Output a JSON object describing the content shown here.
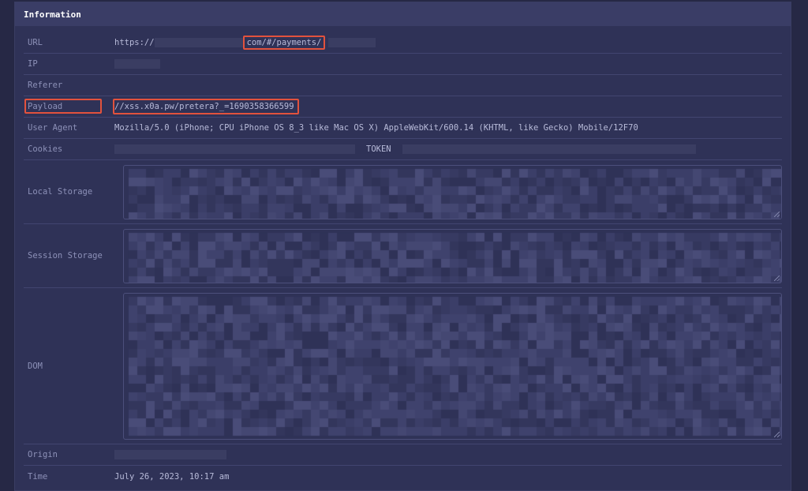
{
  "panel": {
    "title": "Information"
  },
  "fields": {
    "url": {
      "label": "URL",
      "prefix": "https://",
      "highlight": "com/#/payments/"
    },
    "ip": {
      "label": "IP"
    },
    "referer": {
      "label": "Referer"
    },
    "payload": {
      "label": "Payload",
      "value": "//xss.x0a.pw/pretera?_=1690358366599"
    },
    "user_agent": {
      "label": "User Agent",
      "value": "Mozilla/5.0 (iPhone; CPU iPhone OS 8_3 like Mac OS X) AppleWebKit/600.14 (KHTML, like Gecko) Mobile/12F70"
    },
    "cookies": {
      "label": "Cookies",
      "visible_text": "TOKEN"
    },
    "local_storage": {
      "label": "Local Storage"
    },
    "session_storage": {
      "label": "Session Storage"
    },
    "dom": {
      "label": "DOM"
    },
    "origin": {
      "label": "Origin"
    },
    "time": {
      "label": "Time",
      "value": "July 26, 2023, 10:17 am"
    }
  },
  "colors": {
    "highlight": "#e2523d",
    "redaction": "#3a3d62"
  }
}
